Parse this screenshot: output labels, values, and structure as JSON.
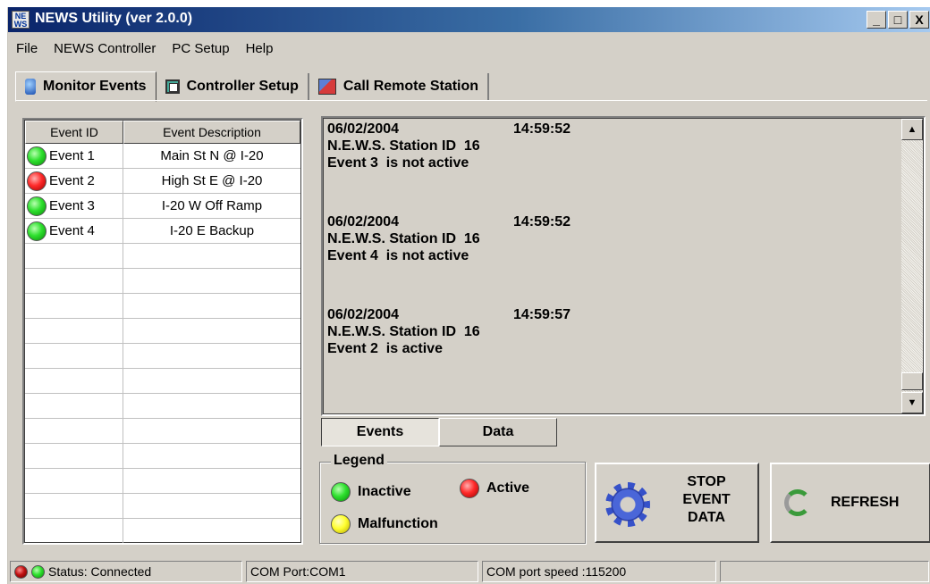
{
  "window": {
    "title": "NEWS Utility (ver 2.0.0)",
    "icon_label_top": "NE",
    "icon_label_bottom": "WS",
    "controls": {
      "minimize": "_",
      "maximize": "□",
      "close": "X"
    }
  },
  "menu": {
    "items": [
      {
        "label": "File"
      },
      {
        "label": "NEWS Controller"
      },
      {
        "label": "PC Setup"
      },
      {
        "label": "Help"
      }
    ]
  },
  "tabs": [
    {
      "label": "Monitor Events",
      "icon": "monitor-icon",
      "active": true
    },
    {
      "label": "Controller Setup",
      "icon": "controller-icon",
      "active": false
    },
    {
      "label": "Call Remote Station",
      "icon": "phone-station-icon",
      "active": false
    }
  ],
  "event_table": {
    "headers": {
      "id": "Event ID",
      "description": "Event Description"
    },
    "rows": [
      {
        "id": "Event 1",
        "description": "Main St N @ I-20",
        "state": "inactive"
      },
      {
        "id": "Event 2",
        "description": "High St E @ I-20",
        "state": "active"
      },
      {
        "id": "Event 3",
        "description": "I-20 W Off Ramp",
        "state": "inactive"
      },
      {
        "id": "Event 4",
        "description": "I-20 E Backup",
        "state": "inactive"
      }
    ],
    "empty_rows": 12
  },
  "log": {
    "entries": [
      {
        "date": "06/02/2004",
        "time": "14:59:52",
        "station": "N.E.W.S. Station ID  16",
        "message": "Event 3  is not active"
      },
      {
        "date": "06/02/2004",
        "time": "14:59:52",
        "station": "N.E.W.S. Station ID  16",
        "message": "Event 4  is not active"
      },
      {
        "date": "06/02/2004",
        "time": "14:59:57",
        "station": "N.E.W.S. Station ID  16",
        "message": "Event 2  is active"
      }
    ]
  },
  "subtabs": [
    {
      "label": "Events",
      "active": true
    },
    {
      "label": "Data",
      "active": false
    }
  ],
  "legend": {
    "title": "Legend",
    "inactive": "Inactive",
    "active": "Active",
    "malfunction": "Malfunction"
  },
  "buttons": {
    "stop_event_data": "STOP\nEVENT\nDATA",
    "refresh": "REFRESH"
  },
  "statusbar": {
    "status": "Status: Connected",
    "com_port": "COM Port:COM1",
    "com_speed": "COM port speed :115200"
  },
  "colors": {
    "inactive": "#2ee02e",
    "active": "#ff2a2a",
    "malfunction": "#ffff30",
    "title_bar": "#0a246a"
  }
}
